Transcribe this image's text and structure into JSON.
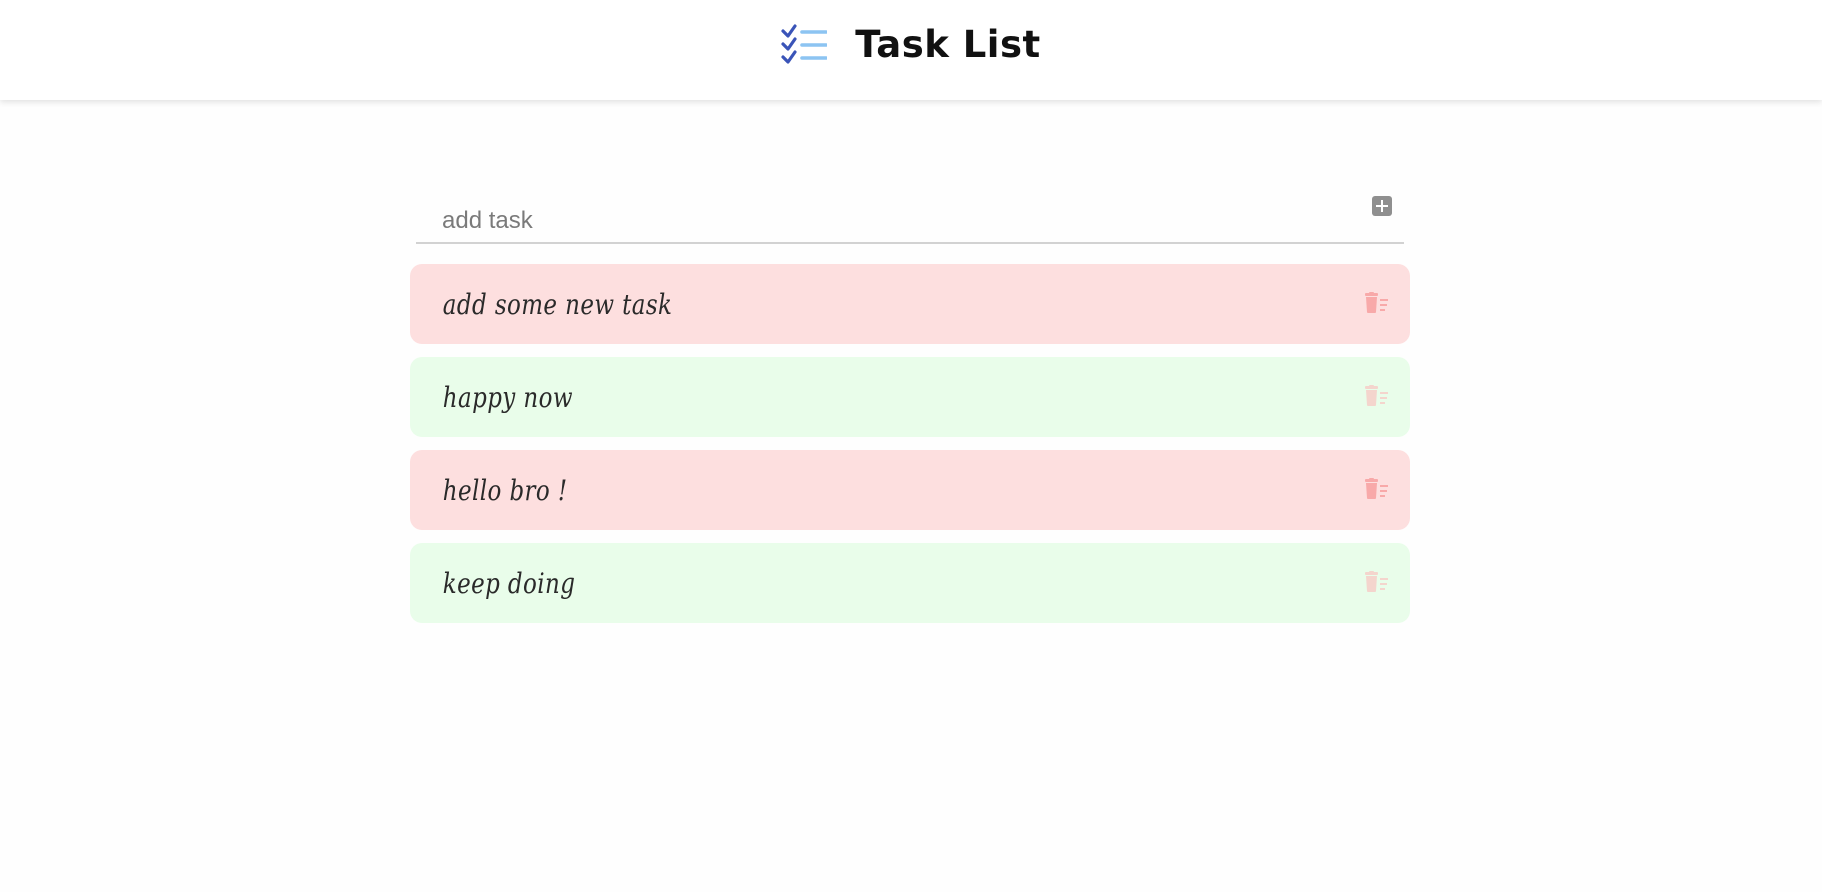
{
  "header": {
    "title": "Task List",
    "logo_icon": "checklist-icon"
  },
  "add_task": {
    "placeholder": "add task",
    "value": "",
    "button_icon": "plus-square-icon"
  },
  "tasks": [
    {
      "text": "add some new task",
      "color": "#fddfdf",
      "trash_color": "#f8a9a9"
    },
    {
      "text": "happy now",
      "color": "#e9fdea",
      "trash_color": "#f4d5cd"
    },
    {
      "text": "hello bro !",
      "color": "#fddfdf",
      "trash_color": "#f8a9a9"
    },
    {
      "text": "keep doing",
      "color": "#e9fdea",
      "trash_color": "#f4d5cd"
    }
  ],
  "colors": {
    "logo_check": "#3a54b8",
    "logo_lines": "#8cc4f2",
    "add_button": "#8f8f8f"
  }
}
